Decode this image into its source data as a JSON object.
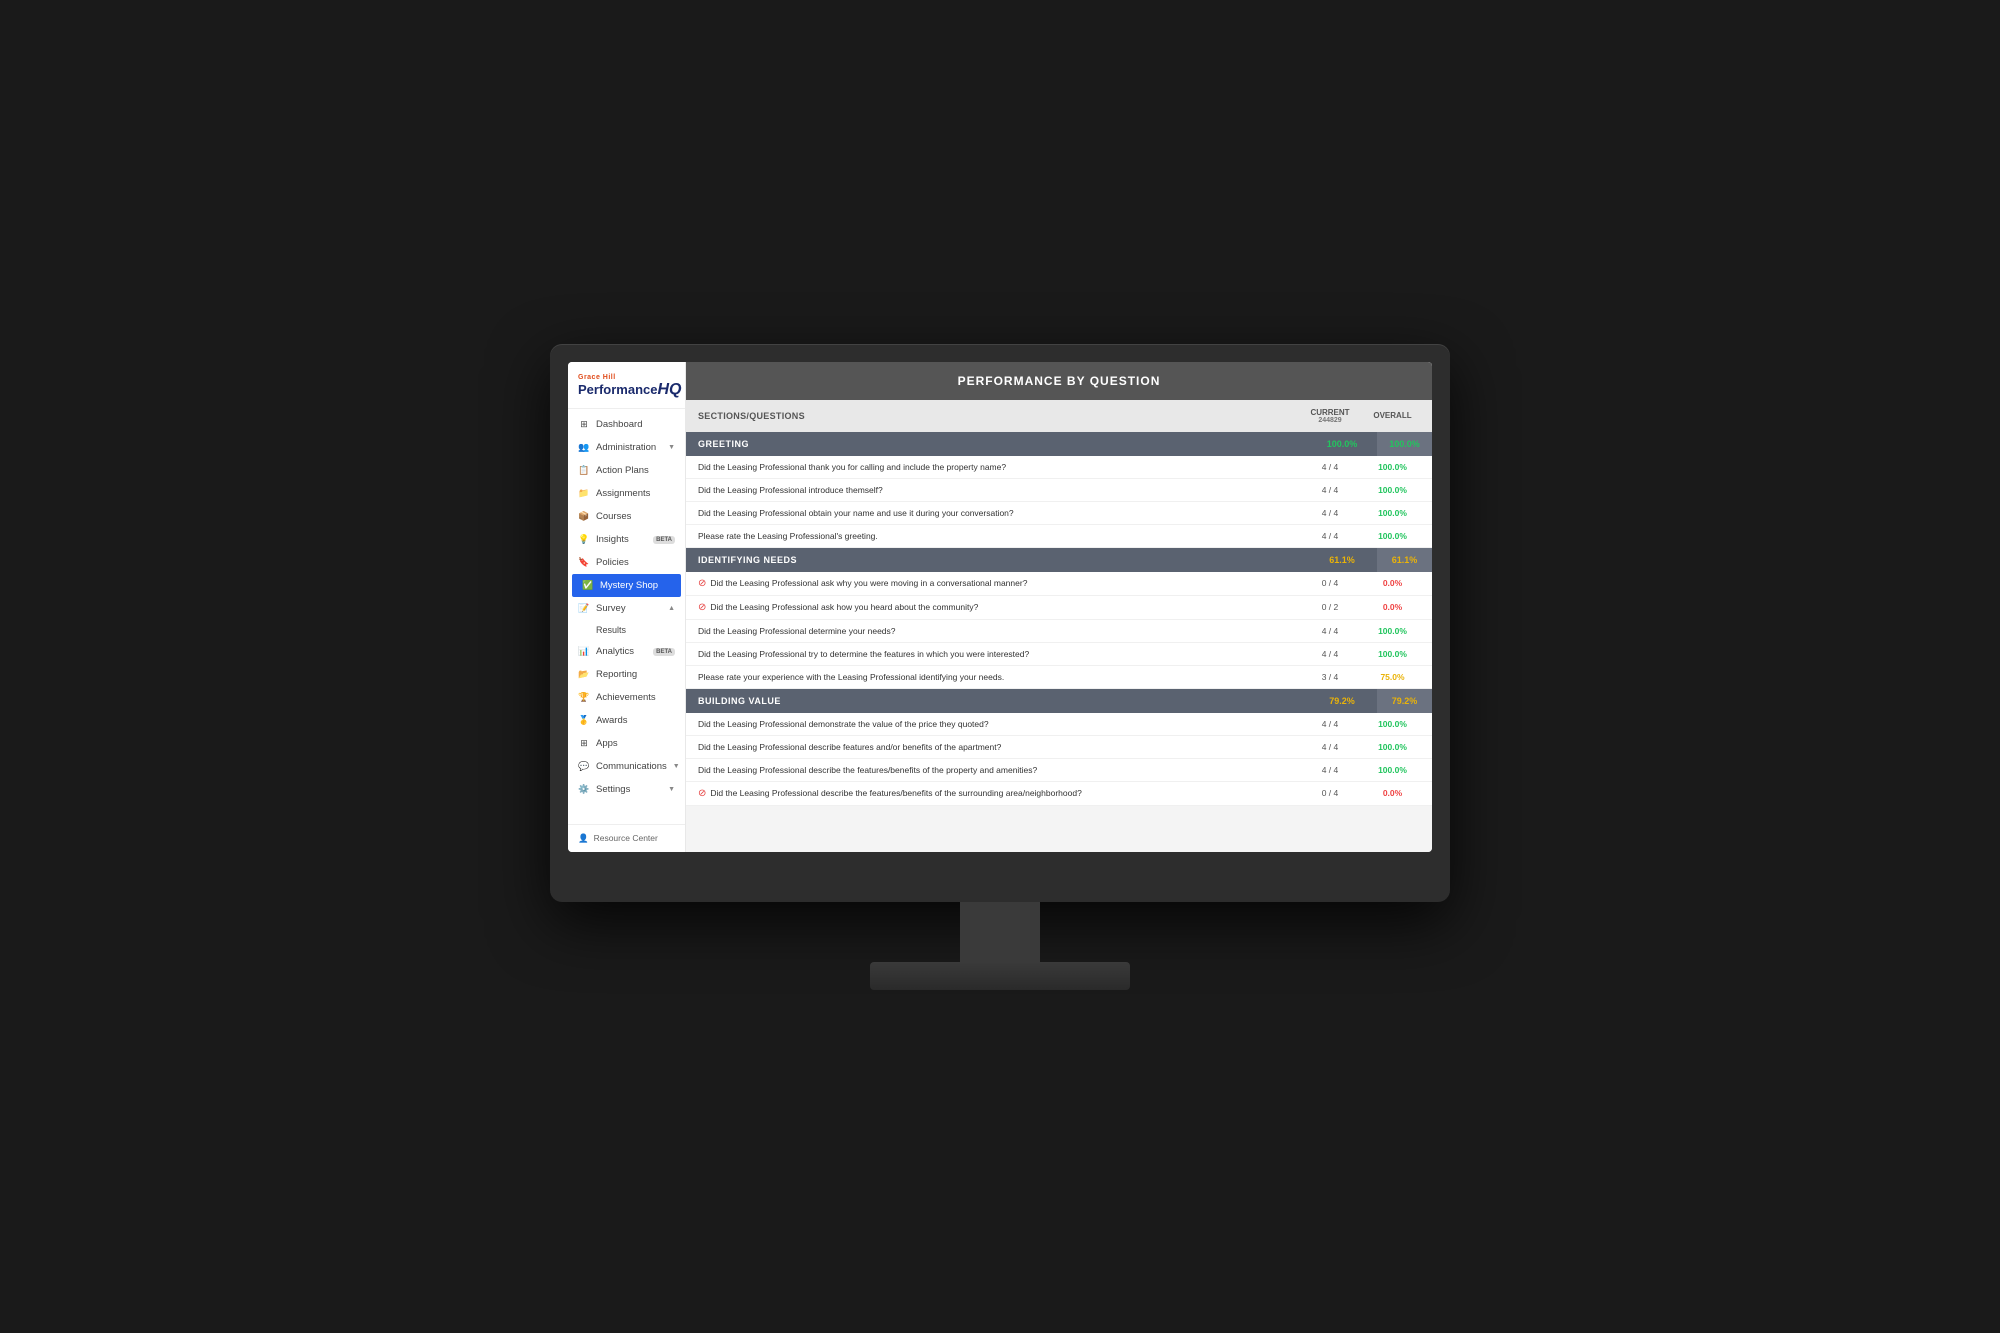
{
  "brand": {
    "company": "Grace Hill",
    "product": "Performance",
    "hq": "HQ"
  },
  "sidebar": {
    "items": [
      {
        "id": "dashboard",
        "label": "Dashboard",
        "icon": "⊞",
        "active": false
      },
      {
        "id": "administration",
        "label": "Administration",
        "icon": "👥",
        "active": false,
        "hasArrow": true
      },
      {
        "id": "action-plans",
        "label": "Action Plans",
        "icon": "📋",
        "active": false
      },
      {
        "id": "assignments",
        "label": "Assignments",
        "icon": "📁",
        "active": false
      },
      {
        "id": "courses",
        "label": "Courses",
        "icon": "📦",
        "active": false
      },
      {
        "id": "insights",
        "label": "Insights",
        "icon": "💡",
        "active": false,
        "badge": "BETA"
      },
      {
        "id": "policies",
        "label": "Policies",
        "icon": "🔖",
        "active": false
      },
      {
        "id": "mystery-shop",
        "label": "Mystery Shop",
        "icon": "✅",
        "active": true
      },
      {
        "id": "survey",
        "label": "Survey",
        "icon": "📝",
        "active": false,
        "hasArrow": true,
        "expanded": true
      },
      {
        "id": "analytics",
        "label": "Analytics",
        "icon": "📊",
        "active": false,
        "badge": "BETA"
      },
      {
        "id": "reporting",
        "label": "Reporting",
        "icon": "📂",
        "active": false
      },
      {
        "id": "achievements",
        "label": "Achievements",
        "icon": "🏆",
        "active": false
      },
      {
        "id": "awards",
        "label": "Awards",
        "icon": "🥇",
        "active": false
      },
      {
        "id": "apps",
        "label": "Apps",
        "icon": "⊞",
        "active": false
      },
      {
        "id": "communications",
        "label": "Communications",
        "icon": "💬",
        "active": false,
        "hasArrow": true
      },
      {
        "id": "settings",
        "label": "Settings",
        "icon": "⚙️",
        "active": false,
        "hasArrow": true
      }
    ],
    "sub_items": [
      {
        "label": "Results"
      }
    ],
    "resource_center": "Resource Center"
  },
  "main": {
    "page_title": "PERFORMANCE BY QUESTION",
    "table_headers": {
      "sections_questions": "SECTIONS/QUESTIONS",
      "current": "CURRENT",
      "current_sub": "244829",
      "overall": "OVERALL"
    },
    "sections": [
      {
        "id": "greeting",
        "label": "GREETING",
        "score_current": "100.0%",
        "score_overall": "100.0%",
        "score_color": "green",
        "questions": [
          {
            "text": "Did the Leasing Professional thank you for calling and include the property name?",
            "score_current": "4 / 4",
            "score_overall": "100.0%",
            "score_color": "green",
            "has_error": false
          },
          {
            "text": "Did the Leasing Professional introduce themself?",
            "score_current": "4 / 4",
            "score_overall": "100.0%",
            "score_color": "green",
            "has_error": false
          },
          {
            "text": "Did the Leasing Professional obtain your name and use it during your conversation?",
            "score_current": "4 / 4",
            "score_overall": "100.0%",
            "score_color": "green",
            "has_error": false
          },
          {
            "text": "Please rate the Leasing Professional's greeting.",
            "score_current": "4 / 4",
            "score_overall": "100.0%",
            "score_color": "green",
            "has_error": false
          }
        ]
      },
      {
        "id": "identifying-needs",
        "label": "IDENTIFYING NEEDS",
        "score_current": "61.1%",
        "score_overall": "61.1%",
        "score_color": "yellow",
        "questions": [
          {
            "text": "Did the Leasing Professional ask why you were moving in a conversational manner?",
            "score_current": "0 / 4",
            "score_overall": "0.0%",
            "score_color": "red",
            "has_error": true
          },
          {
            "text": "Did the Leasing Professional ask how you heard about the community?",
            "score_current": "0 / 2",
            "score_overall": "0.0%",
            "score_color": "red",
            "has_error": true
          },
          {
            "text": "Did the Leasing Professional determine your needs?",
            "score_current": "4 / 4",
            "score_overall": "100.0%",
            "score_color": "green",
            "has_error": false
          },
          {
            "text": "Did the Leasing Professional try to determine the features in which you were interested?",
            "score_current": "4 / 4",
            "score_overall": "100.0%",
            "score_color": "green",
            "has_error": false
          },
          {
            "text": "Please rate your experience with the Leasing Professional identifying your needs.",
            "score_current": "3 / 4",
            "score_overall": "75.0%",
            "score_color": "yellow",
            "has_error": false
          }
        ]
      },
      {
        "id": "building-value",
        "label": "BUILDING VALUE",
        "score_current": "79.2%",
        "score_overall": "79.2%",
        "score_color": "yellow",
        "questions": [
          {
            "text": "Did the Leasing Professional demonstrate the value of the price they quoted?",
            "score_current": "4 / 4",
            "score_overall": "100.0%",
            "score_color": "green",
            "has_error": false
          },
          {
            "text": "Did the Leasing Professional describe features and/or benefits of the apartment?",
            "score_current": "4 / 4",
            "score_overall": "100.0%",
            "score_color": "green",
            "has_error": false
          },
          {
            "text": "Did the Leasing Professional describe the features/benefits of the property and amenities?",
            "score_current": "4 / 4",
            "score_overall": "100.0%",
            "score_color": "green",
            "has_error": false
          },
          {
            "text": "Did the Leasing Professional describe the features/benefits of the surrounding area/neighborhood?",
            "score_current": "0 / 4",
            "score_overall": "0.0%",
            "score_color": "red",
            "has_error": true
          }
        ]
      }
    ]
  }
}
